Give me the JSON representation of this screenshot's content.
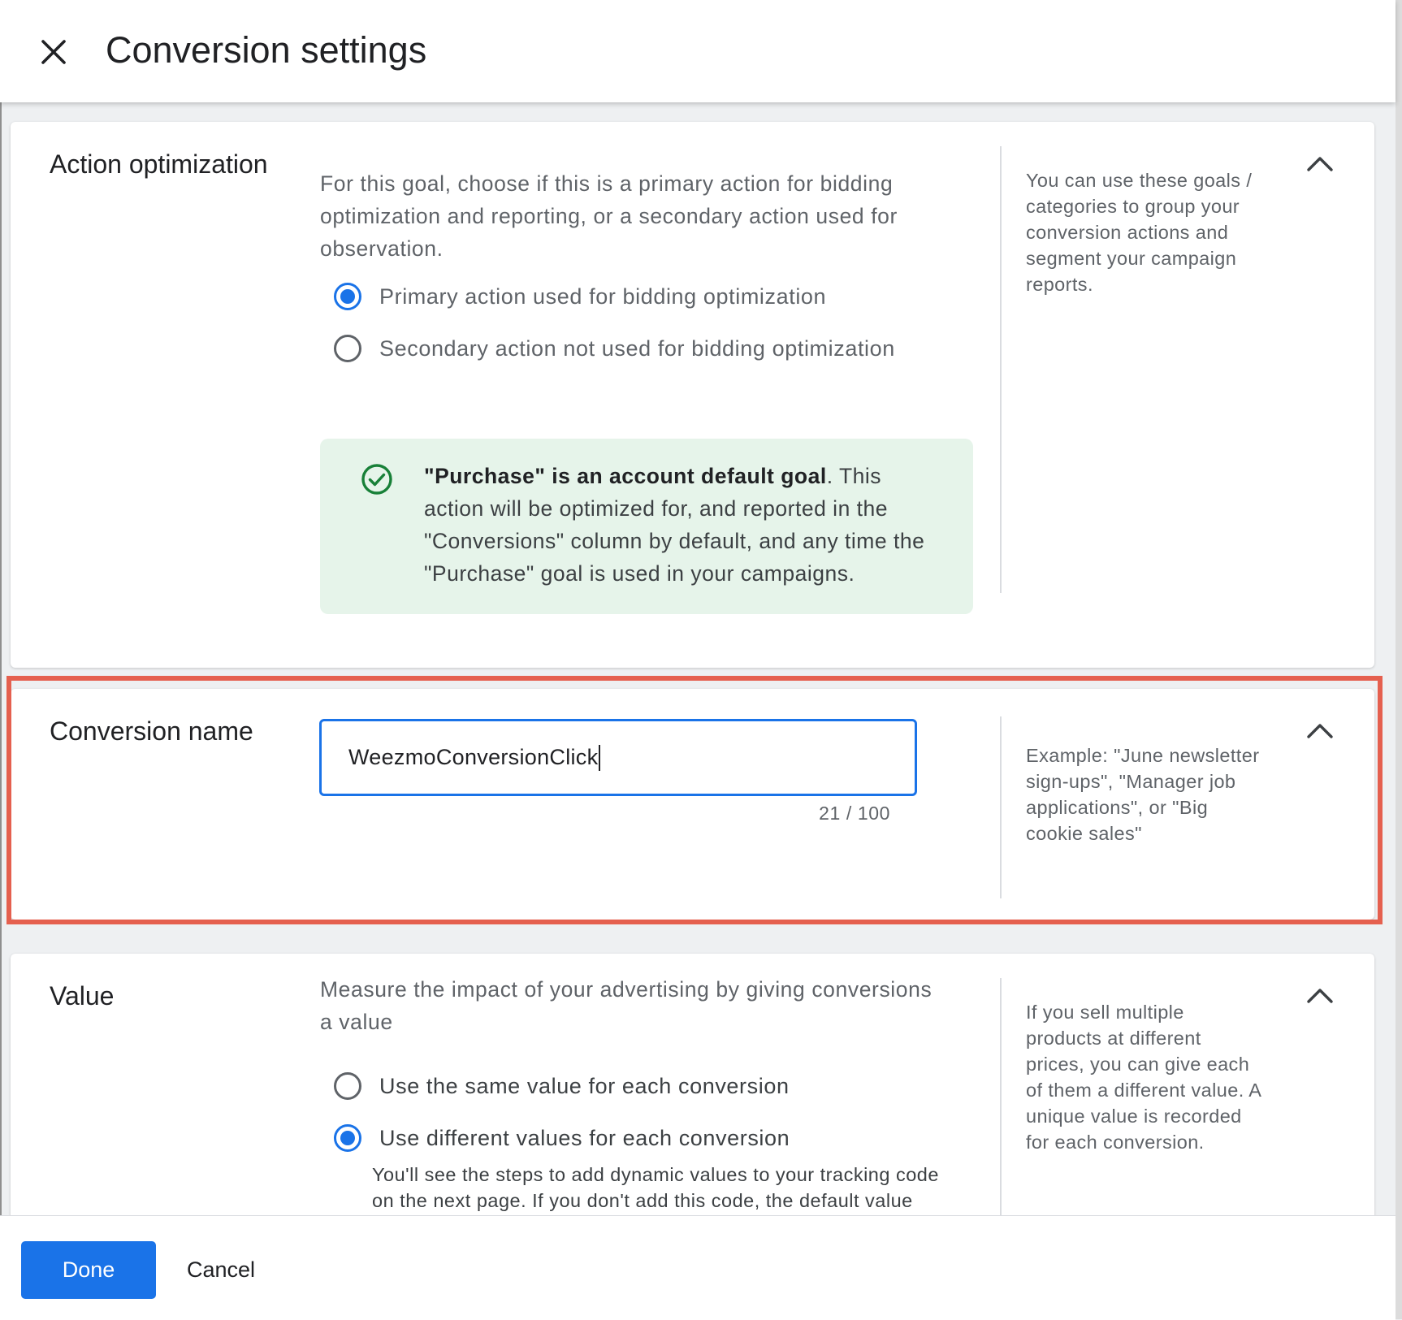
{
  "header": {
    "title": "Conversion settings",
    "close_icon": "close-icon"
  },
  "action_optimization": {
    "title": "Action optimization",
    "description": "For this goal, choose if this is a primary action for bidding optimization and reporting, or a secondary action used for observation.",
    "options": [
      {
        "label": "Primary action used for bidding optimization",
        "selected": true
      },
      {
        "label": "Secondary action not used for bidding optimization",
        "selected": false
      }
    ],
    "info_bold": "\"Purchase\" is an account default goal",
    "info_rest": ". This action will be optimized for, and reported in the \"Conversions\" column by default, and any time the \"Purchase\" goal is used in your campaigns.",
    "help": "You can use these goals / categories to group your conversion actions and segment your campaign reports."
  },
  "conversion_name": {
    "title": "Conversion name",
    "value": "WeezmoConversionClick",
    "char_count": "21 / 100",
    "help": "Example: \"June newsletter sign-ups\", \"Manager job applications\", or \"Big cookie sales\""
  },
  "value_section": {
    "title": "Value",
    "description": "Measure the impact of your advertising by giving conversions a value",
    "options": [
      {
        "label": "Use the same value for each conversion",
        "selected": false
      },
      {
        "label": "Use different values for each conversion",
        "selected": true
      }
    ],
    "option_detail": "You'll see the steps to add dynamic values to your tracking code on the next page. If you don't add this code, the default value",
    "help": "If you sell multiple products at different prices, you can give each of them a different value. A unique value is recorded for each conversion."
  },
  "footer": {
    "done_label": "Done",
    "cancel_label": "Cancel"
  },
  "colors": {
    "accent": "#1a73e8",
    "highlight": "#e5604f",
    "info_bg": "#e6f4ea",
    "success": "#188038"
  }
}
